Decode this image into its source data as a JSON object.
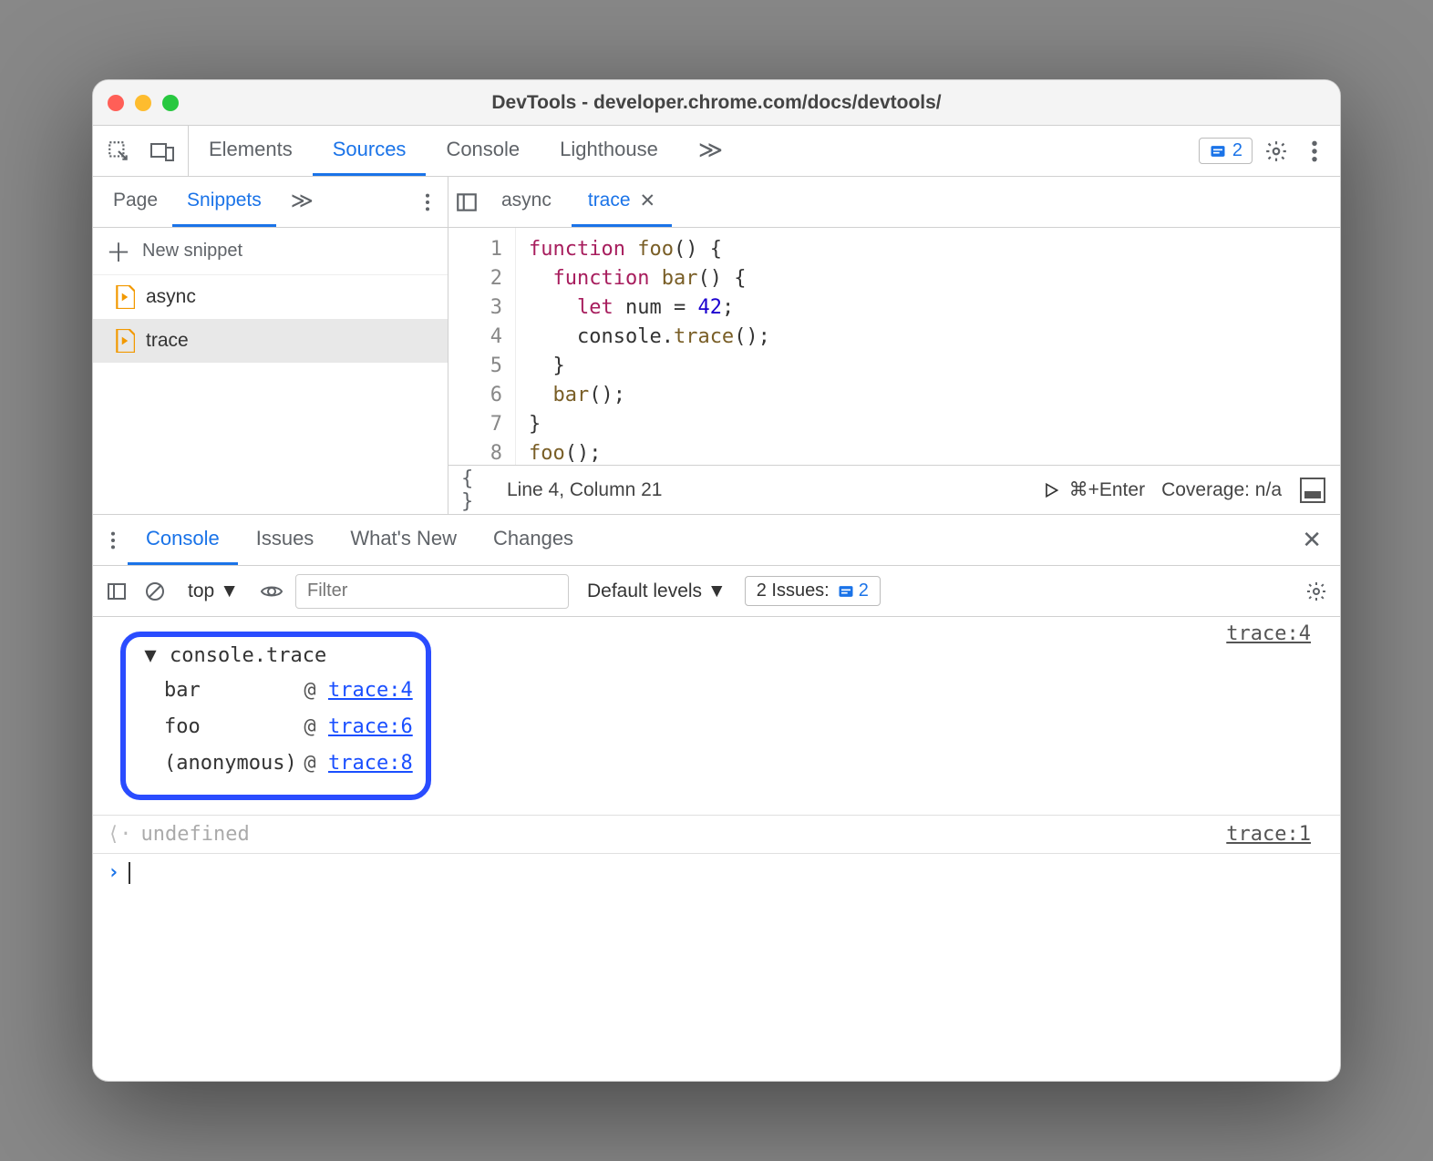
{
  "window": {
    "title": "DevTools - developer.chrome.com/docs/devtools/"
  },
  "toolbar": {
    "tabs": [
      "Elements",
      "Sources",
      "Console",
      "Lighthouse"
    ],
    "active_tab": "Sources",
    "overflow_glyph": "≫",
    "issues_count": "2"
  },
  "sidebar": {
    "tabs": [
      "Page",
      "Snippets"
    ],
    "active_tab": "Snippets",
    "overflow_glyph": "≫",
    "new_snippet_label": "New snippet",
    "items": [
      {
        "name": "async",
        "selected": false
      },
      {
        "name": "trace",
        "selected": true
      }
    ]
  },
  "editor": {
    "tabs": [
      {
        "name": "async",
        "active": false,
        "closable": false
      },
      {
        "name": "trace",
        "active": true,
        "closable": true
      }
    ],
    "code_lines": [
      "function foo() {",
      "  function bar() {",
      "    let num = 42;",
      "    console.trace();",
      "  }",
      "  bar();",
      "}",
      "foo();"
    ],
    "line_numbers": [
      "1",
      "2",
      "3",
      "4",
      "5",
      "6",
      "7",
      "8"
    ],
    "status": {
      "cursor": "Line 4, Column 21",
      "run_hint": "⌘+Enter",
      "coverage": "Coverage: n/a"
    }
  },
  "drawer": {
    "tabs": [
      "Console",
      "Issues",
      "What's New",
      "Changes"
    ],
    "active_tab": "Console",
    "context": "top",
    "filter_placeholder": "Filter",
    "levels": "Default levels",
    "issues_label": "2 Issues:",
    "issues_count": "2"
  },
  "console": {
    "trace_title": "console.trace",
    "source_link": "trace:4",
    "stack": [
      {
        "fn": "bar",
        "loc": "trace:4"
      },
      {
        "fn": "foo",
        "loc": "trace:6"
      },
      {
        "fn": "(anonymous)",
        "loc": "trace:8"
      }
    ],
    "return_value": "undefined",
    "return_source": "trace:1"
  }
}
